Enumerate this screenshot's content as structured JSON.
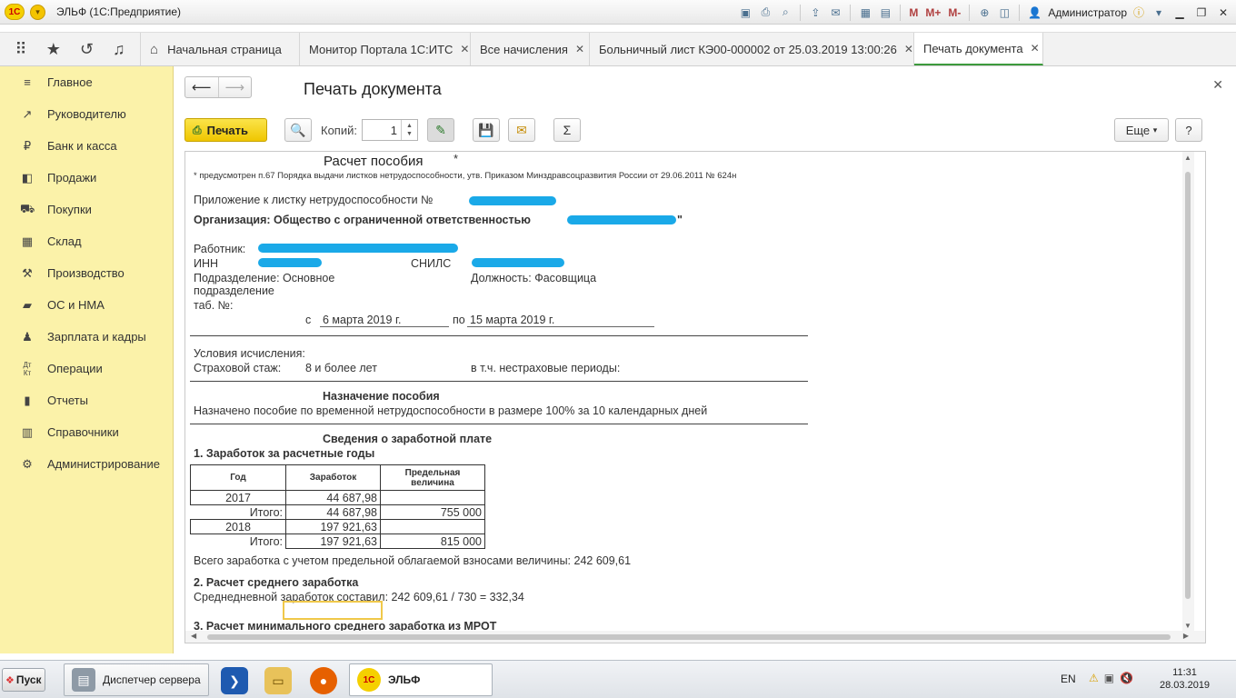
{
  "window": {
    "title": "ЭЛЬФ  (1С:Предприятие)",
    "user": "Администратор",
    "toolbar_m_labels": [
      "M",
      "M+",
      "M-"
    ]
  },
  "tabs": [
    {
      "label": "Начальная страница"
    },
    {
      "label": "Монитор Портала 1С:ИТС"
    },
    {
      "label": "Все начисления"
    },
    {
      "label": "Больничный лист КЭ00-000002 от 25.03.2019 13:00:26"
    },
    {
      "label": "Печать документа"
    }
  ],
  "sidebar": {
    "items": [
      {
        "label": "Главное",
        "icon": "menu-icon"
      },
      {
        "label": "Руководителю",
        "icon": "trend-icon"
      },
      {
        "label": "Банк и касса",
        "icon": "ruble-icon"
      },
      {
        "label": "Продажи",
        "icon": "bag-icon"
      },
      {
        "label": "Покупки",
        "icon": "cart-icon"
      },
      {
        "label": "Склад",
        "icon": "warehouse-icon"
      },
      {
        "label": "Производство",
        "icon": "factory-icon"
      },
      {
        "label": "ОС и НМА",
        "icon": "truck-icon"
      },
      {
        "label": "Зарплата и кадры",
        "icon": "person-icon"
      },
      {
        "label": "Операции",
        "icon": "dt-kt-icon"
      },
      {
        "label": "Отчеты",
        "icon": "bar-chart-icon"
      },
      {
        "label": "Справочники",
        "icon": "book-icon"
      },
      {
        "label": "Администрирование",
        "icon": "gear-icon"
      }
    ]
  },
  "main": {
    "title": "Печать документа",
    "print_label": "Печать",
    "copies_label": "Копий:",
    "copies_value": "1",
    "more_label": "Еще",
    "help_label": "?"
  },
  "doc": {
    "title": "Расчет пособия",
    "title_mark": "*",
    "footnote": "* предусмотрен п.67 Порядка выдачи листков нетрудоспособности, утв. Приказом Минздравсоцразвития России от 29.06.2011 № 624н",
    "appendix": "Приложение к листку нетрудоспособности №",
    "organization": "Организация: Общество с ограниченной ответственностью",
    "org_quote_end": "\"",
    "worker_label": "Работник:",
    "inn_label": "ИНН",
    "snils_label": "СНИЛС",
    "subdivision": "Подразделение: Основное",
    "subdivision_2": "подразделение",
    "position": "Должность: Фасовщица",
    "tab_no": "таб. №:",
    "from_label": "с",
    "from_date": "6 марта 2019 г.",
    "to_label": "по",
    "to_date": "15 марта 2019 г.",
    "conditions": "Условия исчисления:",
    "insurance_label": "Страховой стаж:",
    "insurance_value": "8 и более лет",
    "noninsurance": "в т.ч. нестраховые периоды:",
    "benefit_heading": "Назначение пособия",
    "benefit_text": "Назначено пособие по временной нетрудоспособности в размере 100% за 10 календарных дней",
    "salary_heading": "Сведения о заработной плате",
    "section1": "1. Заработок за расчетные годы",
    "table_headers": [
      "Год",
      "Заработок",
      "Предельная величина"
    ],
    "table_rows": [
      [
        "2017",
        "44 687,98",
        ""
      ],
      [
        "Итого:",
        "44 687,98",
        "755 000"
      ],
      [
        "2018",
        "197 921,63",
        ""
      ],
      [
        "Итого:",
        "197 921,63",
        "815 000"
      ]
    ],
    "total_text": "Всего заработка с учетом предельной облагаемой взносами величины: 242 609,61",
    "section2": "2. Расчет среднего заработка",
    "avg_text": "Среднедневной заработок составил: 242 609,61 / 730 = 332,34",
    "section3": "3. Расчет минимального среднего заработка из МРОТ"
  },
  "taskbar": {
    "start": "Пуск",
    "server_manager": "Диспетчер сервера",
    "app": "ЭЛЬФ",
    "lang": "EN",
    "time": "11:31",
    "date": "28.03.2019"
  }
}
